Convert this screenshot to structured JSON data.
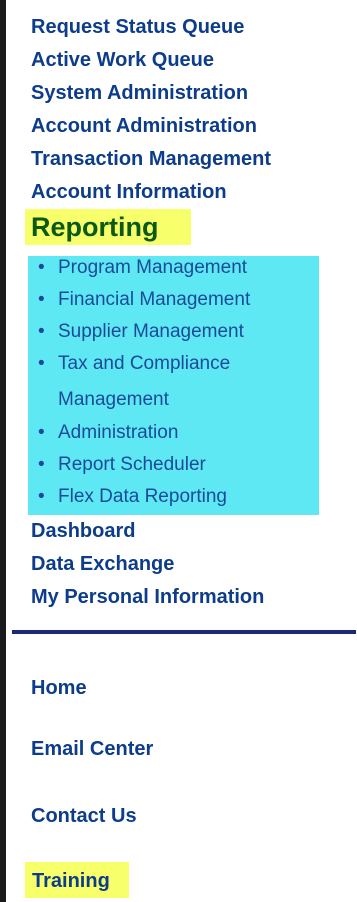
{
  "top_nav": [
    {
      "label": "Request Status Queue"
    },
    {
      "label": "Active Work Queue"
    },
    {
      "label": "System Administration"
    },
    {
      "label": "Account Administration"
    },
    {
      "label": "Transaction Management"
    },
    {
      "label": "Account Information"
    }
  ],
  "reporting": {
    "label": "Reporting",
    "sub_items": [
      {
        "bullet": "•",
        "label": "Program Management"
      },
      {
        "bullet": "•",
        "label": "Financial Management"
      },
      {
        "bullet": "•",
        "label": "Supplier Management"
      },
      {
        "bullet": "•",
        "label": "Tax and Compliance",
        "continuation": "Management"
      },
      {
        "bullet": "•",
        "label": "Administration"
      },
      {
        "bullet": "•",
        "label": "Report Scheduler"
      },
      {
        "bullet": "•",
        "label": "Flex Data Reporting"
      }
    ]
  },
  "post_nav": [
    {
      "label": "Dashboard"
    },
    {
      "label": "Data Exchange"
    },
    {
      "label": "My Personal Information"
    }
  ],
  "footer_nav": [
    {
      "label": "Home"
    },
    {
      "label": "Email Center"
    },
    {
      "label": "Contact Us"
    }
  ],
  "training": {
    "label": "Training"
  },
  "colors": {
    "link": "#0d3d8a",
    "reporting_text": "#0a5a16",
    "highlight_yellow": "#f7ff6b",
    "highlight_cyan": "#5ee8f4",
    "divider": "#1a2a77"
  }
}
